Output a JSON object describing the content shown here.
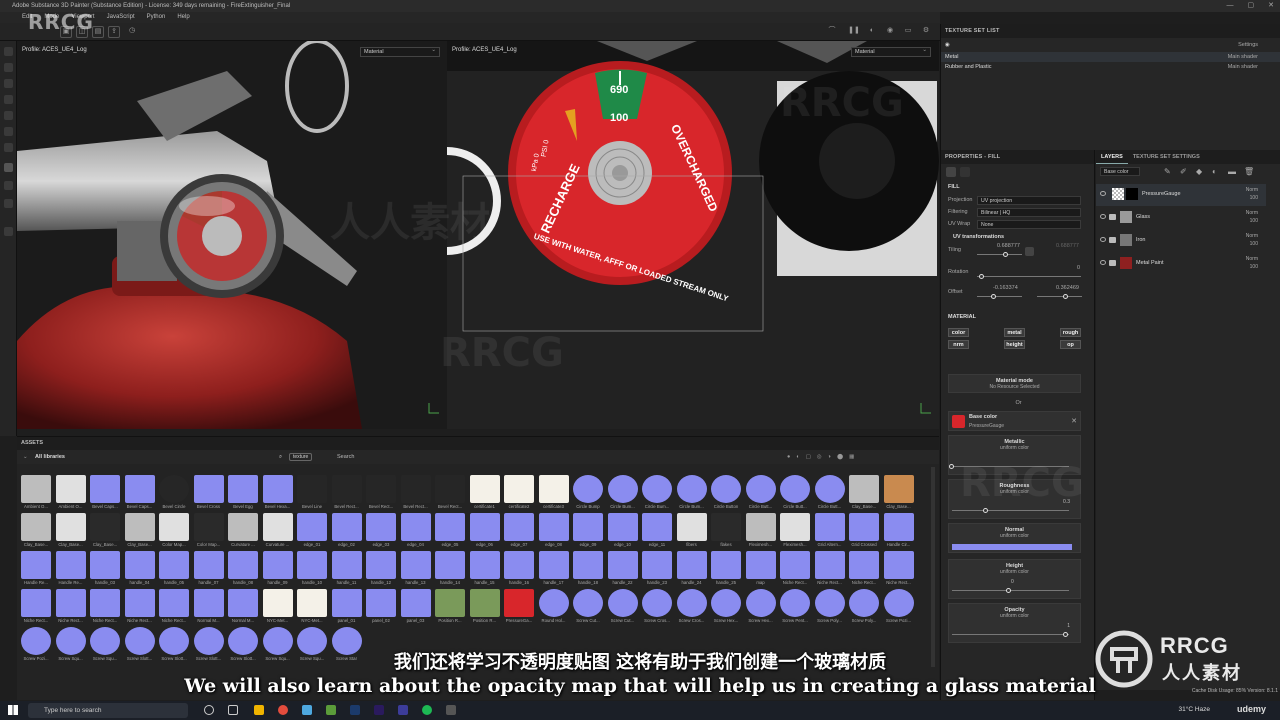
{
  "window": {
    "title": "Adobe Substance 3D Painter (Substance Edition) - License: 349 days remaining - FireExtinguisher_Final"
  },
  "menu": [
    "Edit",
    "Mode",
    "Viewport",
    "JavaScript",
    "Python",
    "Help"
  ],
  "viewport3d": {
    "profile": "Profile: ACES_UE4_Log",
    "mode": "Material"
  },
  "viewport2d": {
    "profile": "Profile: ACES_UE4_Log",
    "mode": "Material",
    "gauge": {
      "top_value": "690",
      "green_value": "100",
      "arc_left": "RECHARGE",
      "arc_right": "OVERCHARGED",
      "bottom_text": "USE WITH WATER, AFFF OR LOADED STREAM ONLY",
      "psi": "PSI 0",
      "kpa": "kPa 0"
    }
  },
  "texture_set_list": {
    "title": "TEXTURE SET LIST",
    "settings_label": "Settings",
    "items": [
      {
        "name": "Metal",
        "shader": "Main shader"
      },
      {
        "name": "Rubber and Plastic",
        "shader": "Main shader"
      }
    ]
  },
  "properties": {
    "title": "PROPERTIES - FILL",
    "fill_label": "FILL",
    "projection_label": "Projection",
    "projection_value": "UV projection",
    "filtering_label": "Filtering",
    "filtering_value": "Bilinear | HQ",
    "uvwrap_label": "UV Wrap",
    "uvwrap_value": "None",
    "uvtrans_label": "UV transformations",
    "tiling_label": "Tiling",
    "tiling_x": "0.688777",
    "tiling_y": "0.688777",
    "rotation_label": "Rotation",
    "rotation_value": "0",
    "offset_label": "Offset",
    "offset_x": "-0.163374",
    "offset_y": "0.362469",
    "material_label": "MATERIAL",
    "channels": [
      "color",
      "metal",
      "rough",
      "nrm",
      "height",
      "op"
    ],
    "material_mode_title": "Material mode",
    "material_mode_value": "No Resource Selected",
    "or_label": "Or",
    "base_color": {
      "title": "Base color",
      "value": "PressureGauge"
    },
    "cards": [
      {
        "title": "Metallic",
        "sub": "uniform color",
        "value": ""
      },
      {
        "title": "Roughness",
        "sub": "uniform color",
        "value": "0.3"
      },
      {
        "title": "Normal",
        "sub": "uniform color",
        "value": ""
      },
      {
        "title": "Height",
        "sub": "uniform color",
        "value": "0"
      },
      {
        "title": "Opacity",
        "sub": "uniform color",
        "value": "1"
      }
    ]
  },
  "layers": {
    "tab_layers": "LAYERS",
    "tab_settings": "TEXTURE SET SETTINGS",
    "channel_select": "Base color",
    "items": [
      {
        "name": "PressureGauge",
        "blend": "Norm",
        "opacity": "100"
      },
      {
        "name": "Glass",
        "blend": "Norm",
        "opacity": "100"
      },
      {
        "name": "Iron",
        "blend": "Norm",
        "opacity": "100"
      },
      {
        "name": "Metal Paint",
        "blend": "Norm",
        "opacity": "100"
      }
    ]
  },
  "assets": {
    "title": "ASSETS",
    "library": "All libraries",
    "search_tag": "texture",
    "search_placeholder": "Search",
    "rows": [
      [
        "Ambient O...",
        "Ambient O...",
        "Bevel Caps...",
        "Bevel Caps...",
        "Bevel Circle",
        "Bevel Cross",
        "Bevel Egg",
        "Bevel Hexa...",
        "Bevel Line",
        "Bevel Rect...",
        "Bevel Rect...",
        "Bevel Rect...",
        "Bevel Rect...",
        "certificate1",
        "certificate2",
        "certificate3",
        "Circle Bump",
        "Circle Bum...",
        "Circle Bum...",
        "Circle Bum...",
        "Circle Button",
        "Circle Butt...",
        "Circle Butt...",
        "Circle Butt...",
        "Clay_Base...",
        "Clay_Base..."
      ],
      [
        "Clay_Base...",
        "Clay_Base...",
        "Clay_Base...",
        "Clay_Base...",
        "Color Map...",
        "Color Map...",
        "Curvature ...",
        "Curvature ...",
        "edge_01",
        "edge_02",
        "edge_03",
        "edge_04",
        "edge_05",
        "edge_06",
        "edge_07",
        "edge_08",
        "edge_09",
        "edge_10",
        "edge_11",
        "fibers",
        "flakes",
        "Fleximesh...",
        "Fleximesh...",
        "Grid Altern...",
        "Grid Crossed",
        "Handle Cir..."
      ],
      [
        "Handle Re...",
        "Handle Re...",
        "handle_03",
        "handle_04",
        "handle_05",
        "handle_07",
        "handle_08",
        "handle_09",
        "handle_10",
        "handle_11",
        "handle_12",
        "handle_13",
        "handle_14",
        "handle_15",
        "handle_16",
        "handle_17",
        "handle_18",
        "handle_22",
        "handle_23",
        "handle_24",
        "handle_25",
        "map",
        "Niche Rect...",
        "Niche Rect...",
        "Niche Rect...",
        "Niche Rect..."
      ],
      [
        "Niche Rect...",
        "Niche Rect...",
        "Niche Rect...",
        "Niche Rect...",
        "Niche Rect...",
        "Normal M...",
        "Normal M...",
        "NYC-Met...",
        "NYC-Met...",
        "panel_01",
        "panel_02",
        "panel_03",
        "Position R...",
        "Position R...",
        "PressureGa...",
        "Round Hol...",
        "Screw Cut...",
        "Screw Cut...",
        "Screw Cros...",
        "Screw Cros...",
        "Screw Hex...",
        "Screw Hex...",
        "Screw Pent...",
        "Screw Poly...",
        "Screw Poly...",
        "Screw Pozi..."
      ],
      [
        "Screw Pozi...",
        "Screw Squ...",
        "Screw Squ...",
        "Screw Slott...",
        "Screw Slott...",
        "Screw Slott...",
        "Screw Slott...",
        "Screw Squ...",
        "Screw Squ...",
        "Screw Star",
        "",
        "",
        "",
        "",
        "",
        "",
        "",
        "",
        "",
        "",
        "",
        "",
        "",
        "",
        "",
        ""
      ]
    ]
  },
  "subtitles": {
    "cn": "我们还将学习不透明度贴图 这将有助于我们创建一个玻璃材质",
    "en": "We will also learn about the opacity map that will help us in creating a glass material"
  },
  "taskbar": {
    "search_placeholder": "Type here to search",
    "weather": "31°C  Haze"
  },
  "status": {
    "cache": "Cache Disk Usage:",
    "cache_value": "85%",
    "version": "Version: 8.1.1"
  },
  "watermarks": {
    "rrcg": "RRCG",
    "cn_brand": "人人素材",
    "udemy": "udemy"
  },
  "colors": {
    "accent_layer": "#8a8cf0",
    "normal_swatch": "#8080ff",
    "gauge_red": "#d8262b",
    "gauge_green": "#1f8a48"
  }
}
